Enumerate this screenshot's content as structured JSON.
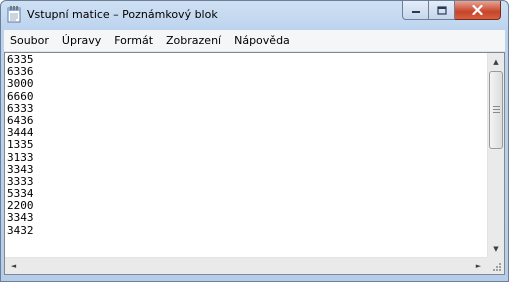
{
  "window": {
    "title": "Vstupní matice – Poznámkový blok"
  },
  "caption_buttons": {
    "minimize_glyph": "–",
    "maximize_glyph": "□",
    "close_glyph": "✕"
  },
  "menu": {
    "items": [
      "Soubor",
      "Úpravy",
      "Formát",
      "Zobrazení",
      "Nápověda"
    ]
  },
  "document": {
    "lines": [
      "6335",
      "6336",
      "3000",
      "6660",
      "6333",
      "6436",
      "3444",
      "1335",
      "3133",
      "3343",
      "3333",
      "5334",
      "2200",
      "3343",
      "3432"
    ]
  },
  "scrollbar": {
    "up_glyph": "▲",
    "down_glyph": "▼",
    "left_glyph": "◄",
    "right_glyph": "►"
  }
}
